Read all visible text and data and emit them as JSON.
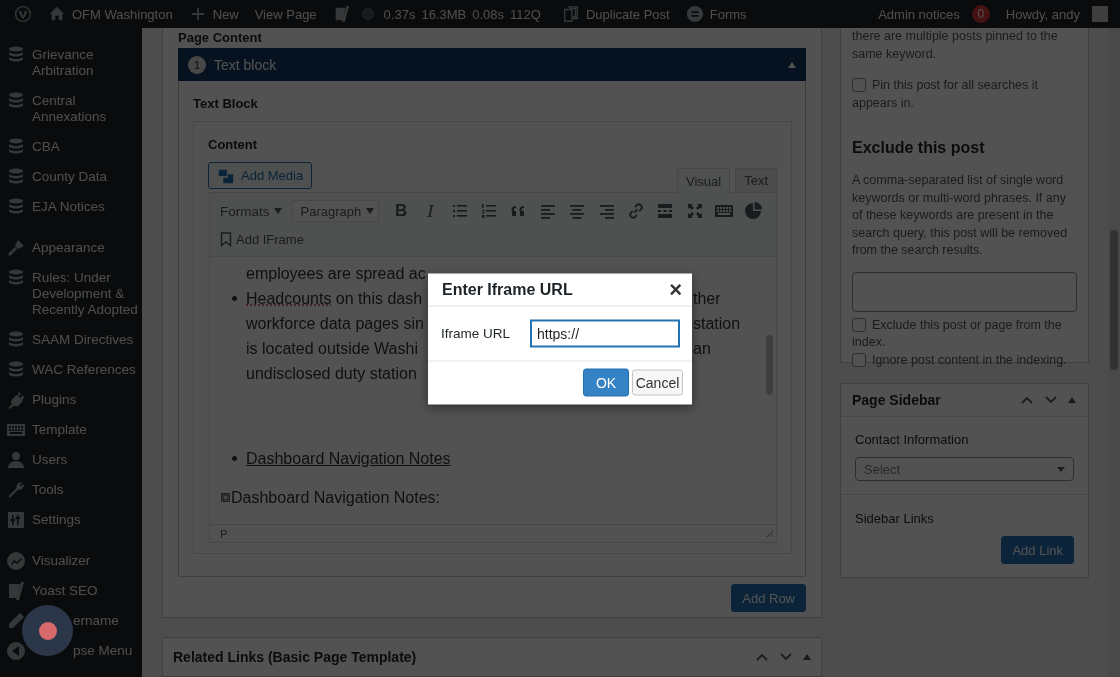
{
  "admin_bar": {
    "site": "OFM Washington",
    "new": "New",
    "view_page": "View Page",
    "stats": [
      "0.37s",
      "16.3MB",
      "0.08s",
      "112Q"
    ],
    "duplicate": "Duplicate Post",
    "forms": "Forms",
    "admin_notices": "Admin notices",
    "notice_count": "0",
    "howdy": "Howdy, andy"
  },
  "sidebar": {
    "groups": [
      [
        {
          "label": "Grievance Arbitration",
          "kind": "plain"
        },
        {
          "label": "Central Annexations",
          "kind": "plain"
        },
        {
          "label": "CBA",
          "kind": "plain"
        },
        {
          "label": "County Data",
          "kind": "plain"
        },
        {
          "label": "EJA Notices",
          "kind": "plain"
        }
      ],
      [
        {
          "label": "Appearance",
          "kind": "plain"
        },
        {
          "label": "Rules: Under Development & Recently Adopted",
          "kind": "plain"
        },
        {
          "label": "SAAM Directives",
          "kind": "plain"
        },
        {
          "label": "WAC References",
          "kind": "plain"
        },
        {
          "label": "Plugins",
          "kind": "plain"
        },
        {
          "label": "Template",
          "kind": "plain"
        },
        {
          "label": "Users",
          "kind": "plain"
        },
        {
          "label": "Tools",
          "kind": "plain"
        },
        {
          "label": "Settings",
          "kind": "plain"
        }
      ],
      [
        {
          "label": "Visualizer",
          "kind": "plain"
        },
        {
          "label": "Yoast SEO",
          "kind": "plain"
        },
        {
          "label": "ername",
          "kind": "covered"
        },
        {
          "label": "pse Menu",
          "kind": "covered"
        }
      ]
    ]
  },
  "page_content": {
    "title": "Page Content",
    "block": {
      "number": "1",
      "title": "Text block",
      "expanded": true
    },
    "field_label": "Text Block",
    "content_label": "Content",
    "add_media": "Add Media",
    "editor_tabs": [
      {
        "label": "Visual",
        "selected": true
      },
      {
        "label": "Text",
        "selected": false
      }
    ],
    "formats": "Formats",
    "paragraph": "Paragraph",
    "toolbar": [
      {
        "kind": "bold",
        "glyph": "B"
      },
      {
        "kind": "italic",
        "glyph": "I"
      },
      {
        "kind": "bullets"
      },
      {
        "kind": "numbers"
      },
      {
        "kind": "quote"
      },
      {
        "kind": "align-left"
      },
      {
        "kind": "align-center"
      },
      {
        "kind": "align-right"
      },
      {
        "kind": "link"
      },
      {
        "kind": "more"
      },
      {
        "kind": "fullscreen"
      },
      {
        "kind": "keyboard"
      },
      {
        "kind": "pie"
      }
    ],
    "add_iframe": "Add IFrame",
    "blocks": [
      {
        "kind": "wrap",
        "lines": [
          {
            "left": "employees are spread ac"
          }
        ]
      },
      {
        "kind": "bullet",
        "spell": "Headcounts",
        "lines": [
          {
            "left": " on this dash",
            "right": "ther"
          },
          {
            "left": "workforce data pages sin",
            "right": "station"
          },
          {
            "left": "is located outside Washi",
            "right": "an"
          },
          {
            "left": "undisclosed duty station"
          }
        ]
      },
      {
        "kind": "link",
        "text": "Dashboard Navigation Notes"
      },
      {
        "kind": "anchor",
        "text": "Dashboard Navigation Notes:"
      }
    ],
    "path": "P",
    "add_row": "Add Row"
  },
  "related_links": {
    "title": "Related Links (Basic Page Template)"
  },
  "search_pin": {
    "text": "there are multiple posts pinned to the same keyword.",
    "pin": {
      "label": "Pin this post for all searches it appears in.",
      "checked": false
    }
  },
  "exclude": {
    "heading": "Exclude this post",
    "description": "A comma-separated list of single word keywords or multi-word phrases. If any of these keywords are present in the search query, this post will be removed from the search results.",
    "options": [
      {
        "label": "Exclude this post or page from the index.",
        "checked": false
      },
      {
        "label": "Ignore post content in the indexing.",
        "checked": false
      }
    ]
  },
  "page_sidebar": {
    "title": "Page Sidebar",
    "contact_label": "Contact Information",
    "select_placeholder": "Select",
    "links_label": "Sidebar Links",
    "add_link": "Add Link"
  },
  "dialog": {
    "title": "Enter Iframe URL",
    "close": "×",
    "field_label": "Iframe URL",
    "value": "https://",
    "ok": "OK",
    "cancel": "Cancel"
  }
}
